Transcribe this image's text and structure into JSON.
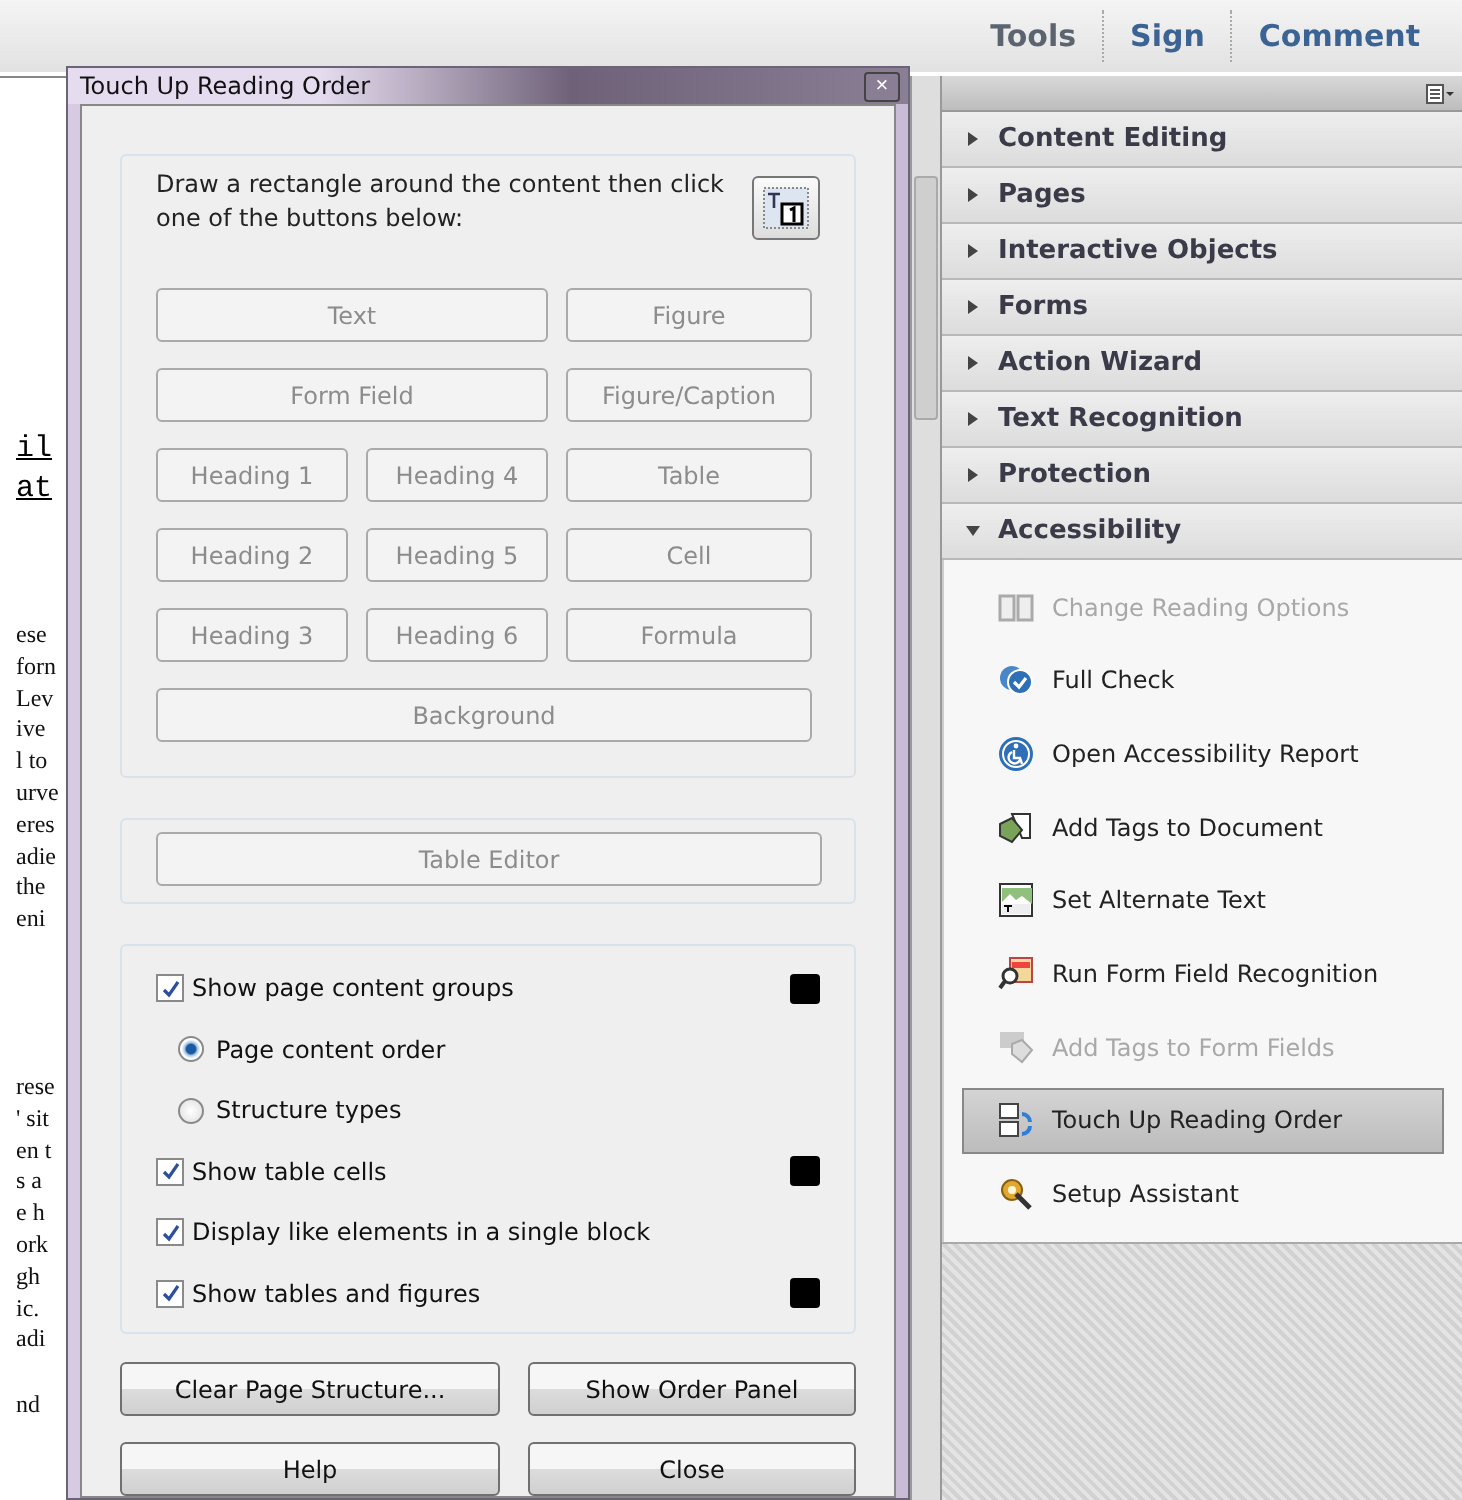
{
  "top_tabs": [
    {
      "label": "Tools",
      "selected": true
    },
    {
      "label": "Sign",
      "selected": false
    },
    {
      "label": "Comment",
      "selected": false
    }
  ],
  "document_blocks": [
    {
      "kind": "mono",
      "lines": [
        "il",
        "at"
      ]
    },
    {
      "kind": "serif",
      "lines": [
        "ese",
        "forn",
        "Lev",
        "ive",
        "l to",
        "urve",
        "eres",
        "adie",
        "the",
        "eni"
      ]
    },
    {
      "kind": "serif",
      "lines": [
        "rese",
        "' sit",
        "en t",
        "s a",
        "e h",
        "ork",
        "gh",
        "ic.",
        "adi"
      ]
    },
    {
      "kind": "serif",
      "lines": [
        "nd"
      ]
    }
  ],
  "dialog": {
    "title": "Touch Up Reading Order",
    "close": "×",
    "instruction": "Draw a rectangle around the content then click one of the buttons below:",
    "button_rows": [
      [
        {
          "label": "Text",
          "disabled": true
        },
        {
          "label": "Figure",
          "disabled": true
        }
      ],
      [
        {
          "label": "Form Field",
          "disabled": true
        },
        {
          "label": "Figure/Caption",
          "disabled": true
        }
      ],
      [
        {
          "label": "Heading 1",
          "disabled": true
        },
        {
          "label": "Heading 4",
          "disabled": true
        },
        {
          "label": "Table",
          "disabled": true
        }
      ],
      [
        {
          "label": "Heading 2",
          "disabled": true
        },
        {
          "label": "Heading 5",
          "disabled": true
        },
        {
          "label": "Cell",
          "disabled": true
        }
      ],
      [
        {
          "label": "Heading 3",
          "disabled": true
        },
        {
          "label": "Heading 6",
          "disabled": true
        },
        {
          "label": "Formula",
          "disabled": true
        }
      ],
      [
        {
          "label": "Background",
          "disabled": true
        }
      ]
    ],
    "table_editor": {
      "label": "Table Editor",
      "disabled": true
    },
    "options": [
      {
        "kind": "checkbox",
        "label": "Show page content groups",
        "checked": true,
        "color": "#000000"
      },
      {
        "kind": "radio",
        "label": "Page content order",
        "selected": true
      },
      {
        "kind": "radio",
        "label": "Structure types",
        "selected": false
      },
      {
        "kind": "checkbox",
        "label": "Show table cells",
        "checked": true,
        "color": "#000000"
      },
      {
        "kind": "checkbox",
        "label": "Display like elements in a single block",
        "checked": true
      },
      {
        "kind": "checkbox",
        "label": "Show tables and figures",
        "checked": true,
        "color": "#000000"
      }
    ],
    "buttons": [
      "Clear Page Structure...",
      "Show Order Panel",
      "Help",
      "Close"
    ]
  },
  "panel": {
    "sections": [
      {
        "label": "Content Editing",
        "expanded": false
      },
      {
        "label": "Pages",
        "expanded": false
      },
      {
        "label": "Interactive Objects",
        "expanded": false
      },
      {
        "label": "Forms",
        "expanded": false
      },
      {
        "label": "Action Wizard",
        "expanded": false
      },
      {
        "label": "Text Recognition",
        "expanded": false
      },
      {
        "label": "Protection",
        "expanded": false
      },
      {
        "label": "Accessibility",
        "expanded": true
      }
    ],
    "tools": [
      {
        "label": "Change Reading Options",
        "disabled": true,
        "selected": false
      },
      {
        "label": "Full Check",
        "disabled": false,
        "selected": false
      },
      {
        "label": "Open Accessibility Report",
        "disabled": false,
        "selected": false
      },
      {
        "label": "Add Tags to Document",
        "disabled": false,
        "selected": false
      },
      {
        "label": "Set Alternate Text",
        "disabled": false,
        "selected": false
      },
      {
        "label": "Run Form Field Recognition",
        "disabled": false,
        "selected": false
      },
      {
        "label": "Add Tags to Form Fields",
        "disabled": true,
        "selected": false
      },
      {
        "label": "Touch Up Reading Order",
        "disabled": false,
        "selected": true
      },
      {
        "label": "Setup Assistant",
        "disabled": false,
        "selected": false
      }
    ]
  }
}
